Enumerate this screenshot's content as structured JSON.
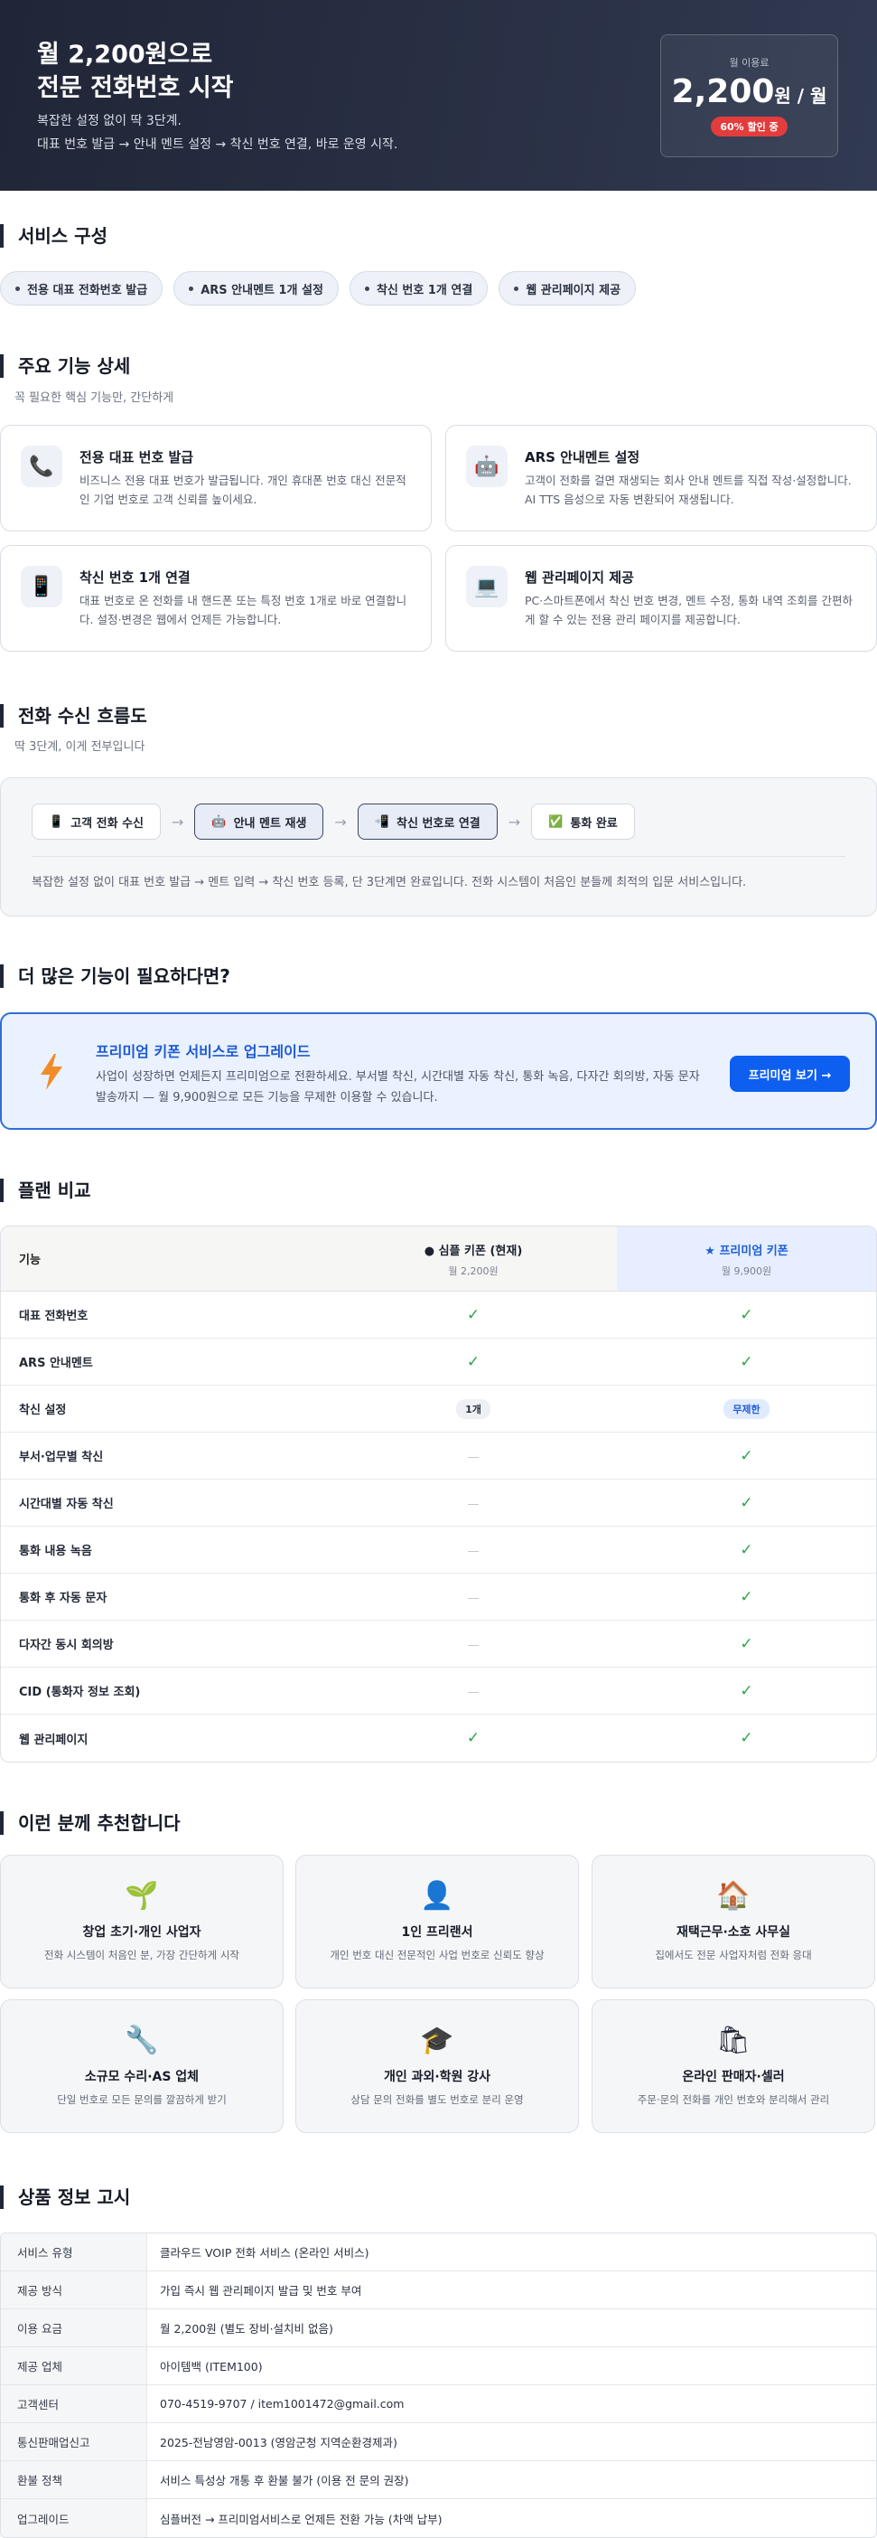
{
  "hero": {
    "title_line1": "월 2,200원으로",
    "title_line2": "전문 전화번호 시작",
    "desc_line1": "복잡한 설정 없이 딱 3단계.",
    "desc_line2": "대표 번호 발급 → 안내 멘트 설정 → 착신 번호 연결, 바로 운영 시작.",
    "price_label": "월 이용료",
    "price_amount": "2,200",
    "price_unit": "원 / 월",
    "discount_badge": "60% 할인 중"
  },
  "services": {
    "title": "서비스 구성",
    "chips": [
      "전용 대표 전화번호 발급",
      "ARS 안내멘트 1개 설정",
      "착신 번호 1개 연결",
      "웹 관리페이지 제공"
    ]
  },
  "features": {
    "title": "주요 기능 상세",
    "subtitle": "꼭 필요한 핵심 기능만, 간단하게",
    "cards": [
      {
        "icon": "phone-icon",
        "glyph": "📞",
        "title": "전용 대표 번호 발급",
        "desc": "비즈니스 전용 대표 번호가 발급됩니다. 개인 휴대폰 번호 대신 전문적인 기업 번호로 고객 신뢰를 높이세요."
      },
      {
        "icon": "robot-icon",
        "glyph": "🤖",
        "title": "ARS 안내멘트 설정",
        "desc": "고객이 전화를 걸면 재생되는 회사 안내 멘트를 직접 작성·설정합니다. AI TTS 음성으로 자동 변환되어 재생됩니다."
      },
      {
        "icon": "mobile-icon",
        "glyph": "📱",
        "title": "착신 번호 1개 연결",
        "desc": "대표 번호로 온 전화를 내 핸드폰 또는 특정 번호 1개로 바로 연결합니다. 설정·변경은 웹에서 언제든 가능합니다."
      },
      {
        "icon": "computer-icon",
        "glyph": "💻",
        "title": "웹 관리페이지 제공",
        "desc": "PC·스마트폰에서 착신 번호 변경, 멘트 수정, 통화 내역 조회를 간편하게 할 수 있는 전용 관리 페이지를 제공합니다."
      }
    ]
  },
  "flow": {
    "title": "전화 수신 흐름도",
    "subtitle": "딱 3단계, 이게 전부입니다",
    "steps": [
      {
        "icon": "phone-icon",
        "glyph": "📱",
        "label": "고객 전화 수신"
      },
      {
        "icon": "robot-icon",
        "glyph": "🤖",
        "label": "안내 멘트 재생"
      },
      {
        "icon": "forward-icon",
        "glyph": "📲",
        "label": "착신 번호로 연결"
      },
      {
        "icon": "check-icon",
        "glyph": "✅",
        "label": "통화 완료"
      }
    ],
    "arrow": "→",
    "note": "복잡한 설정 없이 대표 번호 발급 → 멘트 입력 → 착신 번호 등록, 단 3단계면 완료입니다. 전화 시스템이 처음인 분들께 최적의 입문 서비스입니다."
  },
  "more": {
    "title": "더 많은 기능이 필요하다면?",
    "premium_title": "프리미엄 키폰 서비스로 업그레이드",
    "premium_desc": "사업이 성장하면 언제든지 프리미엄으로 전환하세요. 부서별 착신, 시간대별 자동 착신, 통화 녹음, 다자간 회의방, 자동 문자 발송까지 — 월 9,900원으로 모든 기능을 무제한 이용할 수 있습니다.",
    "button": "프리미엄 보기 →"
  },
  "plans": {
    "title": "플랜 비교",
    "col_feature": "기능",
    "simple_name": "● 심플 키폰 (현재)",
    "simple_price": "월 2,200원",
    "premium_name": "★ 프리미엄 키폰",
    "premium_price": "월 9,900원",
    "check": "✓",
    "dash": "—",
    "rows": [
      {
        "feature": "대표 전화번호",
        "simple": "check",
        "premium": "check"
      },
      {
        "feature": "ARS 안내멘트",
        "simple": "check",
        "premium": "check"
      },
      {
        "feature": "착신 설정",
        "simple": "1개",
        "premium": "무제한"
      },
      {
        "feature": "부서·업무별 착신",
        "simple": "dash",
        "premium": "check"
      },
      {
        "feature": "시간대별 자동 착신",
        "simple": "dash",
        "premium": "check"
      },
      {
        "feature": "통화 내용 녹음",
        "simple": "dash",
        "premium": "check"
      },
      {
        "feature": "통화 후 자동 문자",
        "simple": "dash",
        "premium": "check"
      },
      {
        "feature": "다자간 동시 회의방",
        "simple": "dash",
        "premium": "check"
      },
      {
        "feature": "CID (통화자 정보 조회)",
        "simple": "dash",
        "premium": "check"
      },
      {
        "feature": "웹 관리페이지",
        "simple": "check",
        "premium": "check"
      }
    ]
  },
  "recommend": {
    "title": "이런 분께 추천합니다",
    "cards": [
      {
        "icon": "sprout-icon",
        "glyph": "🌱",
        "title": "창업 초기·개인 사업자",
        "desc": "전화 시스템이 처음인 분, 가장 간단하게 시작"
      },
      {
        "icon": "person-icon",
        "glyph": "👤",
        "title": "1인 프리랜서",
        "desc": "개인 번호 대신 전문적인 사업 번호로 신뢰도 향상"
      },
      {
        "icon": "house-icon",
        "glyph": "🏠",
        "title": "재택근무·소호 사무실",
        "desc": "집에서도 전문 사업자처럼 전화 응대"
      },
      {
        "icon": "wrench-icon",
        "glyph": "🔧",
        "title": "소규모 수리·AS 업체",
        "desc": "단일 번호로 모든 문의를 깔끔하게 받기"
      },
      {
        "icon": "graduation-cap-icon",
        "glyph": "🎓",
        "title": "개인 과외·학원 강사",
        "desc": "상담 문의 전화를 별도 번호로 분리 운영"
      },
      {
        "icon": "shopping-bag-icon",
        "glyph": "🛍",
        "title": "온라인 판매자·셀러",
        "desc": "주문·문의 전화를 개인 번호와 분리해서 관리"
      }
    ]
  },
  "notice": {
    "title": "상품 정보 고시",
    "rows": [
      {
        "key": "서비스 유형",
        "value": "클라우드 VOIP 전화 서비스 (온라인 서비스)"
      },
      {
        "key": "제공 방식",
        "value": "가입 즉시 웹 관리페이지 발급 및 번호 부여"
      },
      {
        "key": "이용 요금",
        "value": "월 2,200원 (별도 장비·설치비 없음)"
      },
      {
        "key": "제공 업체",
        "value": "아이템백 (ITEM100)"
      },
      {
        "key": "고객센터",
        "value": "070-4519-9707 / item1001472@gmail.com"
      },
      {
        "key": "통신판매업신고",
        "value": "2025-전남영암-0013 (영암군청 지역순환경제과)"
      },
      {
        "key": "환불 정책",
        "value": "서비스 특성상 개통 후 환불 불가 (이용 전 문의 권장)"
      },
      {
        "key": "업그레이드",
        "value": "심플버전 → 프리미엄서비스로 언제든 전환 가능 (차액 납부)"
      }
    ]
  }
}
